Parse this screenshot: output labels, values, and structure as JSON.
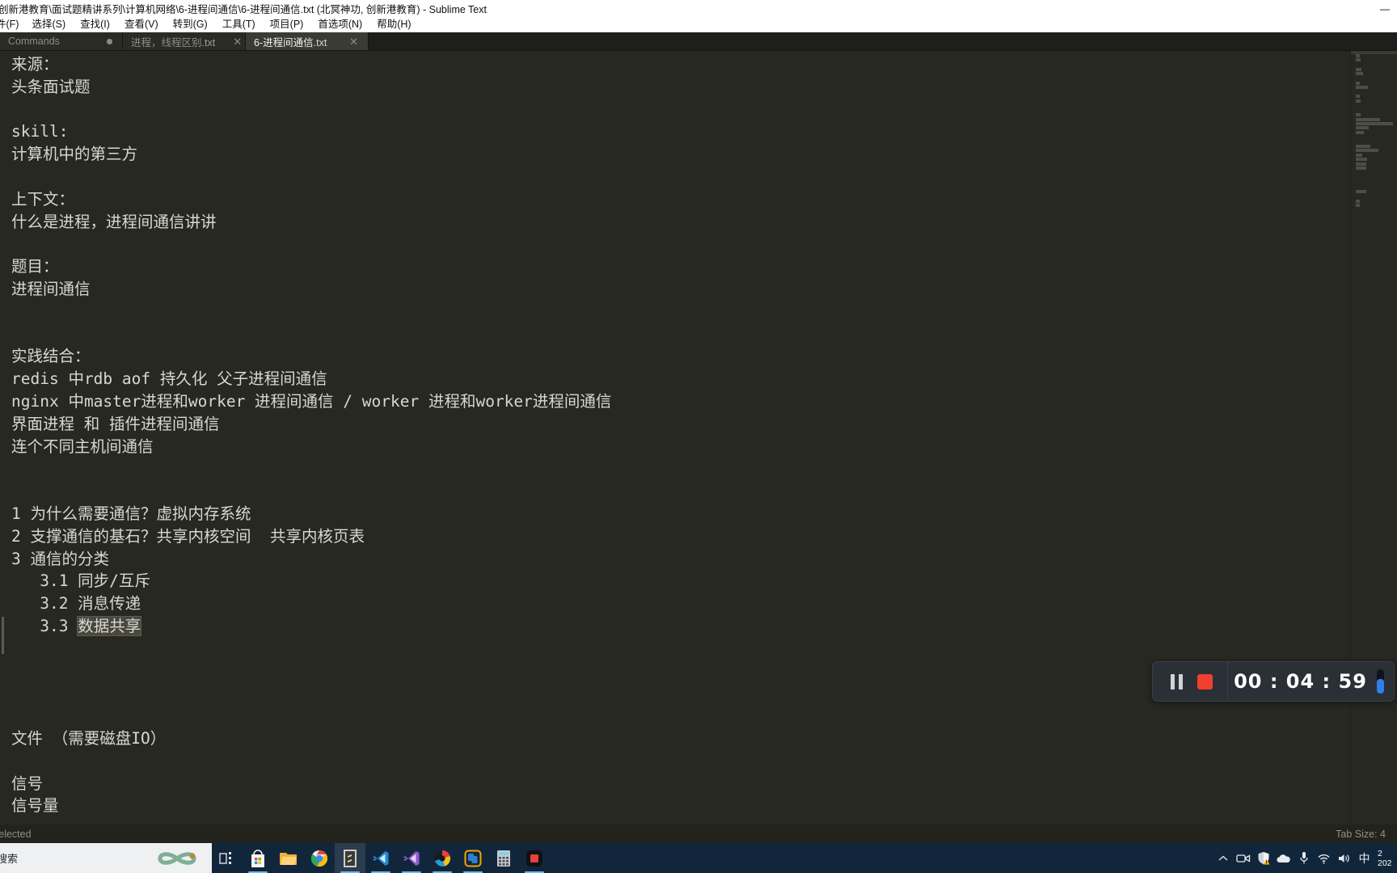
{
  "window": {
    "title": "创新港教育\\面试题精讲系列\\计算机网络\\6-进程间通信\\6-进程间通信.txt (北冥神功, 创新港教育) - Sublime Text",
    "minimize_label": "—"
  },
  "menu": {
    "items": [
      {
        "label": "件(F)",
        "name": "menu-file"
      },
      {
        "label": "选择(S)",
        "name": "menu-selection"
      },
      {
        "label": "查找(I)",
        "name": "menu-find"
      },
      {
        "label": "查看(V)",
        "name": "menu-view"
      },
      {
        "label": "转到(G)",
        "name": "menu-goto"
      },
      {
        "label": "工具(T)",
        "name": "menu-tools"
      },
      {
        "label": "项目(P)",
        "name": "menu-project"
      },
      {
        "label": "首选项(N)",
        "name": "menu-preferences"
      },
      {
        "label": "帮助(H)",
        "name": "menu-help"
      }
    ]
  },
  "tabs": [
    {
      "label": "Commands",
      "ext": "",
      "state": "modified",
      "active": false
    },
    {
      "label": "进程，线程区别",
      "ext": ".txt",
      "state": "close",
      "active": false
    },
    {
      "label": "6-进程间通信",
      "ext": ".txt",
      "state": "close",
      "active": true
    }
  ],
  "editor": {
    "lines": [
      "来源：",
      "头条面试题",
      "",
      "skill:",
      "计算机中的第三方",
      "",
      "上下文：",
      "什么是进程，进程间通信讲讲",
      "",
      "题目：",
      "进程间通信",
      "",
      "",
      "实践结合：",
      "redis 中rdb aof 持久化 父子进程间通信",
      "nginx 中master进程和worker 进程间通信 / worker 进程和worker进程间通信",
      "界面进程 和 插件进程间通信",
      "连个不同主机间通信",
      "",
      "",
      "1 为什么需要通信？虚拟内存系统",
      "2 支撑通信的基石？共享内核空间  共享内核页表",
      "3 通信的分类",
      "   3.1 同步/互斥",
      "   3.2 消息传递",
      "   3.3 数据共享",
      "",
      "",
      "",
      "",
      "文件 （需要磁盘IO）",
      "",
      "信号",
      "信号量"
    ],
    "selection_line_index": 25,
    "selection_prefix": "   3.3 ",
    "selection_text": "数据共享"
  },
  "statusbar": {
    "left": "selected",
    "right": "Tab Size: 4"
  },
  "recorder": {
    "pause_label": "pause",
    "stop_label": "stop",
    "time": "00 : 04 : 59",
    "accent_stop": "#f0402e",
    "accent_slider": "#2f80ed"
  },
  "taskbar": {
    "search_value": "搜索",
    "icons": [
      {
        "name": "task-view-icon",
        "label": "task-view"
      },
      {
        "name": "microsoft-store-icon",
        "label": "store"
      },
      {
        "name": "file-explorer-icon",
        "label": "explorer"
      },
      {
        "name": "google-chrome-icon",
        "label": "chrome"
      },
      {
        "name": "sublime-text-icon",
        "label": "sublime-text"
      },
      {
        "name": "vscode-icon",
        "label": "vscode"
      },
      {
        "name": "vscode-insiders-icon",
        "label": "vscode-insiders"
      },
      {
        "name": "pycharm-icon",
        "label": "pycharm"
      },
      {
        "name": "copy-q-icon",
        "label": "copyq"
      },
      {
        "name": "calculator-icon",
        "label": "calculator"
      },
      {
        "name": "screen-recorder-icon",
        "label": "recorder"
      }
    ],
    "tray": [
      {
        "name": "show-hidden-icons-chevron-icon",
        "glyph": "⌃"
      },
      {
        "name": "screen-record-tray-icon",
        "glyph": ""
      },
      {
        "name": "security-shield-warning-icon",
        "glyph": ""
      },
      {
        "name": "onedrive-cloud-icon",
        "glyph": ""
      },
      {
        "name": "microphone-tray-icon",
        "glyph": ""
      },
      {
        "name": "wifi-icon",
        "glyph": ""
      },
      {
        "name": "volume-icon",
        "glyph": ""
      },
      {
        "name": "ime-chinese-icon",
        "glyph": "中"
      }
    ],
    "clock_line1": "2",
    "clock_line2": "202"
  }
}
